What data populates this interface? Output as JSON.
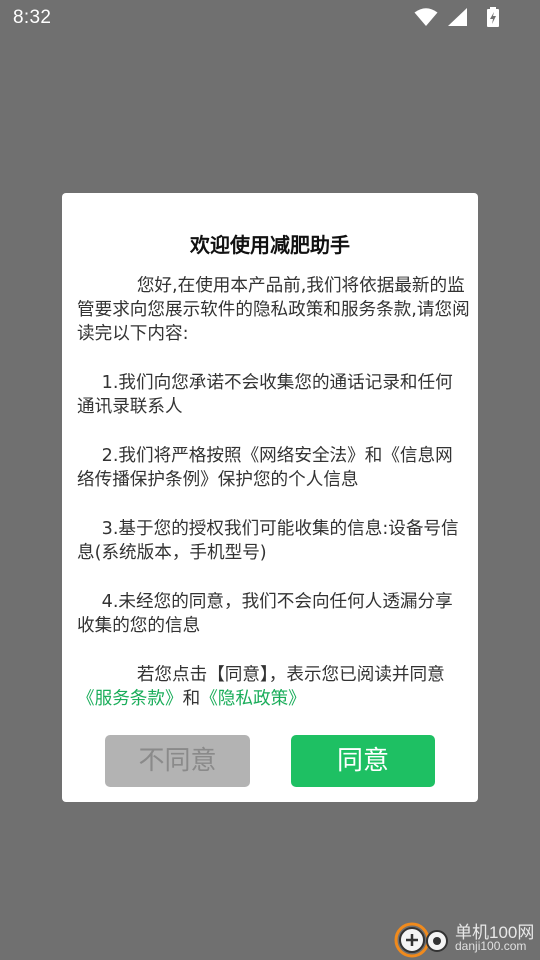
{
  "status_bar": {
    "time": "8:32",
    "icons": [
      "wifi-icon",
      "signal-icon",
      "battery-charging-icon"
    ]
  },
  "dialog": {
    "title": "欢迎使用减肥助手",
    "intro": "您好,在使用本产品前,我们将依据最新的监管要求向您展示软件的隐私政策和服务条款,请您阅读完以下内容:",
    "items": [
      "1.我们向您承诺不会收集您的通话记录和任何通讯录联系人",
      "2.我们将严格按照《网络安全法》和《信息网络传播保护条例》保护您的个人信息",
      "3.基于您的授权我们可能收集的信息:设备号信息(系统版本，手机型号)",
      "4.未经您的同意，我们不会向任何人透漏分享收集的您的信息"
    ],
    "consent_prefix": "若您点击【同意】，表示您已阅读并同意",
    "terms_link": "《服务条款》",
    "consent_and": "和",
    "privacy_link": "《隐私政策》",
    "disagree_label": "不同意",
    "agree_label": "同意"
  },
  "watermark": {
    "name": "单机100网",
    "domain": "danji100.com"
  },
  "colors": {
    "overlay": "#707070",
    "accent_green": "#1ec063",
    "link_green": "#1aad5a",
    "disabled_gray": "#b3b3b3"
  }
}
